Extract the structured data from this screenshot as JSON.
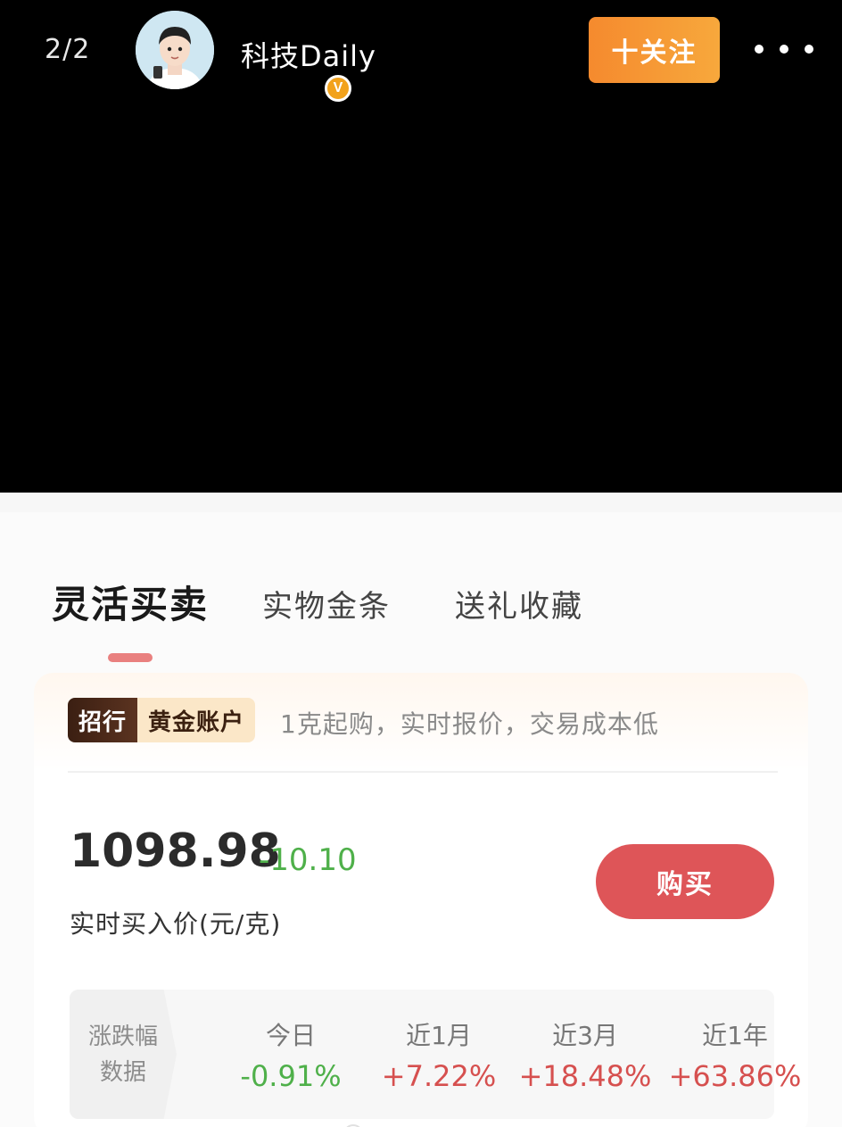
{
  "header": {
    "page_indicator": "2/2",
    "username": "科技Daily",
    "verified_badge": "V",
    "follow_label": "十关注"
  },
  "tabs": [
    {
      "label": "灵活买卖",
      "active": true
    },
    {
      "label": "实物金条",
      "active": false
    },
    {
      "label": "送礼收藏",
      "active": false
    }
  ],
  "account": {
    "badge_left": "招行",
    "badge_right": "黄金账户",
    "description": "1克起购，实时报价，交易成本低"
  },
  "quote": {
    "price": "1098.98",
    "change": "-10.10",
    "label": "实时买入价(元/克)",
    "buy_label": "购买"
  },
  "stats": {
    "label_line1": "涨跌幅",
    "label_line2": "数据",
    "items": [
      {
        "name": "今日",
        "value": "-0.91%",
        "trend": "down"
      },
      {
        "name": "近1月",
        "value": "+7.22%",
        "trend": "up"
      },
      {
        "name": "近3月",
        "value": "+18.48%",
        "trend": "up"
      },
      {
        "name": "近1年",
        "value": "+63.86%",
        "trend": "up"
      }
    ]
  },
  "colors": {
    "accent_orange": "#f58a2e",
    "buy_red": "#de5558",
    "gain_red": "#d6504f",
    "loss_green": "#4fb04a"
  }
}
